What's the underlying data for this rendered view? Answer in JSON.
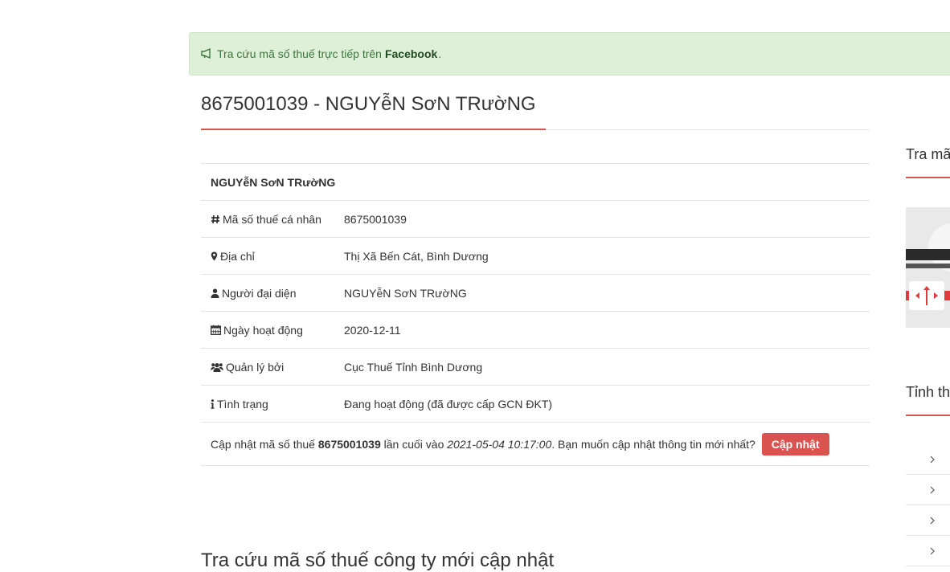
{
  "alert": {
    "text": "Tra cứu mã số thuế trực tiếp trên",
    "link": "Facebook",
    "end": "."
  },
  "page": {
    "title": "8675001039 - NGUYễN SơN TRườNG"
  },
  "info": {
    "name": "NGUYễN SơN TRườNG",
    "rows": [
      {
        "icon": "hash-icon",
        "label": "Mã số thuế cá nhân",
        "value": "8675001039"
      },
      {
        "icon": "map-marker-icon",
        "label": "Địa chỉ",
        "value": "Thị Xã Bến Cát, Bình Dương"
      },
      {
        "icon": "user-icon",
        "label": "Người đại diện",
        "value": "NGUYễN SơN TRườNG"
      },
      {
        "icon": "calendar-icon",
        "label": "Ngày hoạt động",
        "value": "2020-12-11"
      },
      {
        "icon": "users-icon",
        "label": "Quản lý bởi",
        "value": "Cục Thuế Tỉnh Bình Dương"
      },
      {
        "icon": "info-icon",
        "label": "Tình trạng",
        "value": "Đang hoạt động (đã được cấp GCN ĐKT)"
      }
    ],
    "update": {
      "prefix": "Cập nhật mã số thuế",
      "code": "8675001039",
      "middle": "lần cuối vào",
      "time": "2021-05-04 10:17:00",
      "suffix": ". Bạn muốn cập nhật thông tin mới nhất?",
      "button": "Cập nhật"
    }
  },
  "section": {
    "title": "Tra cứu mã số thuế công ty mới cập nhật"
  },
  "sidebar": {
    "title1": "Tra mã",
    "title2": "Tỉnh th",
    "list_count_visible": 4
  },
  "colors": {
    "accent": "#d9534f",
    "alert_bg": "#dff0d8",
    "alert_text": "#3c763d"
  }
}
